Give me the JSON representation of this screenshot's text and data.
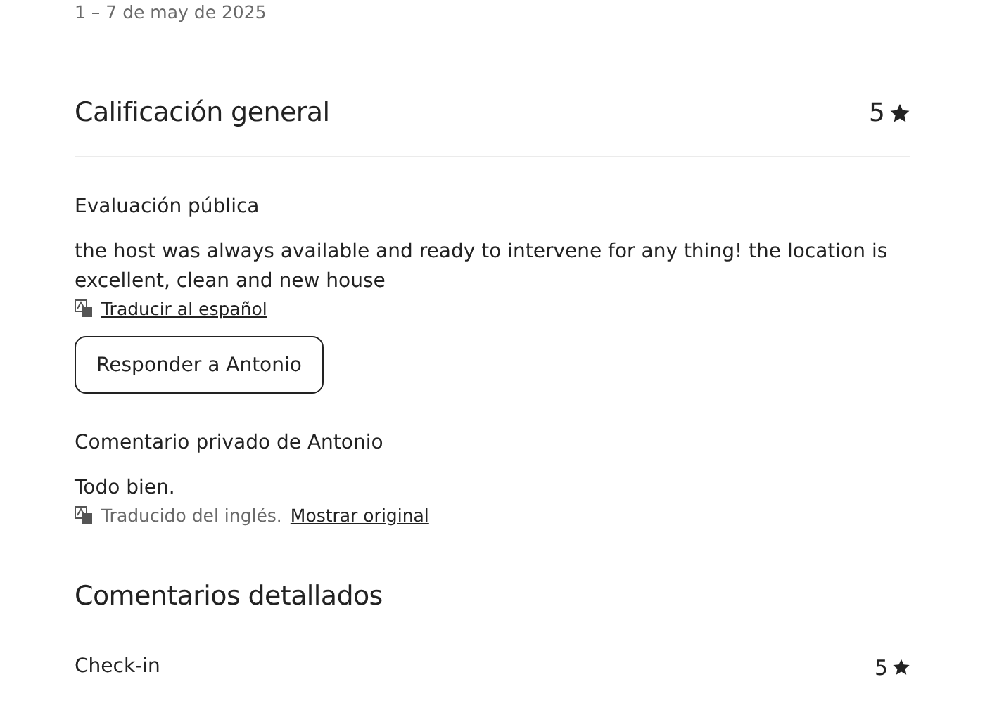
{
  "date_range": "1 – 7 de may de 2025",
  "overall": {
    "title": "Calificación general",
    "score": "5"
  },
  "public_review": {
    "title": "Evaluación pública",
    "text": "the host was always available and ready to intervene for any thing! the location is excellent, clean and new house",
    "translate_link": "Traducir al español"
  },
  "reply_button": "Responder a Antonio",
  "private_comment": {
    "title": "Comentario privado de Antonio",
    "text": "Todo bien.",
    "translated_note": "Traducido del inglés.",
    "original_link": "Mostrar original"
  },
  "detailed": {
    "title": "Comentarios detallados",
    "items": [
      {
        "label": "Check-in",
        "score": "5"
      }
    ]
  }
}
